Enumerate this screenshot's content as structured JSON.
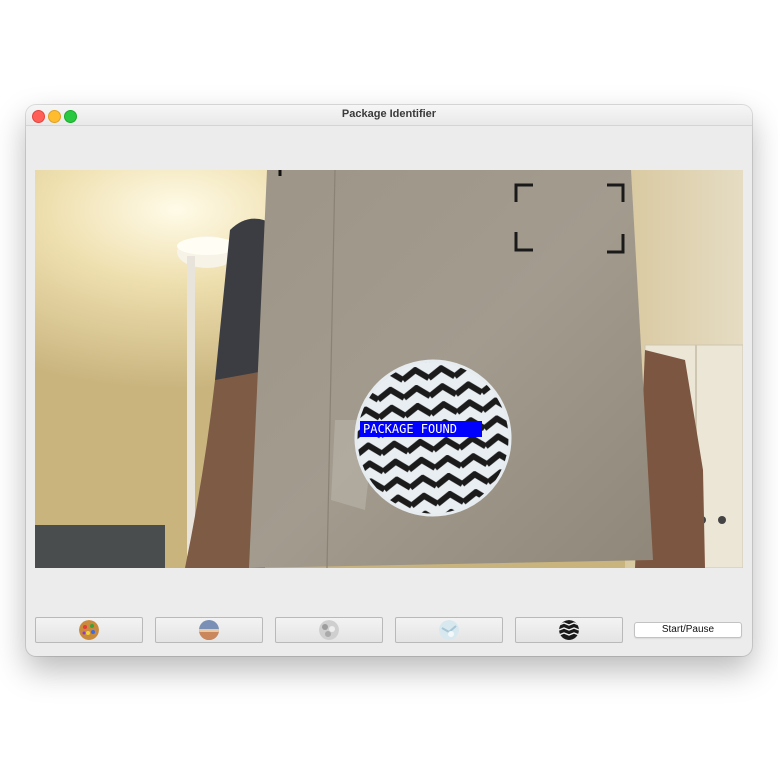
{
  "window": {
    "title": "Package Identifier"
  },
  "camera": {
    "detection_label": "PACKAGE FOUND",
    "detection_color": "#0000ff",
    "detection_text_color": "#ffffff"
  },
  "thumbnails": [
    {
      "name": "sprinkles-pattern",
      "color": "#d98a3a"
    },
    {
      "name": "landscape-photo",
      "color": "#7a8fb5"
    },
    {
      "name": "rocks-texture",
      "color": "#bdbdbd"
    },
    {
      "name": "ice-texture",
      "color": "#cfe2ec"
    },
    {
      "name": "zigzag-pattern",
      "color": "#1a1a1a"
    }
  ],
  "controls": {
    "start_pause_label": "Start/Pause"
  },
  "colors": {
    "window_bg": "#ececec",
    "accent_close": "#ff5f57",
    "accent_min": "#febc2e",
    "accent_max": "#28c840"
  }
}
